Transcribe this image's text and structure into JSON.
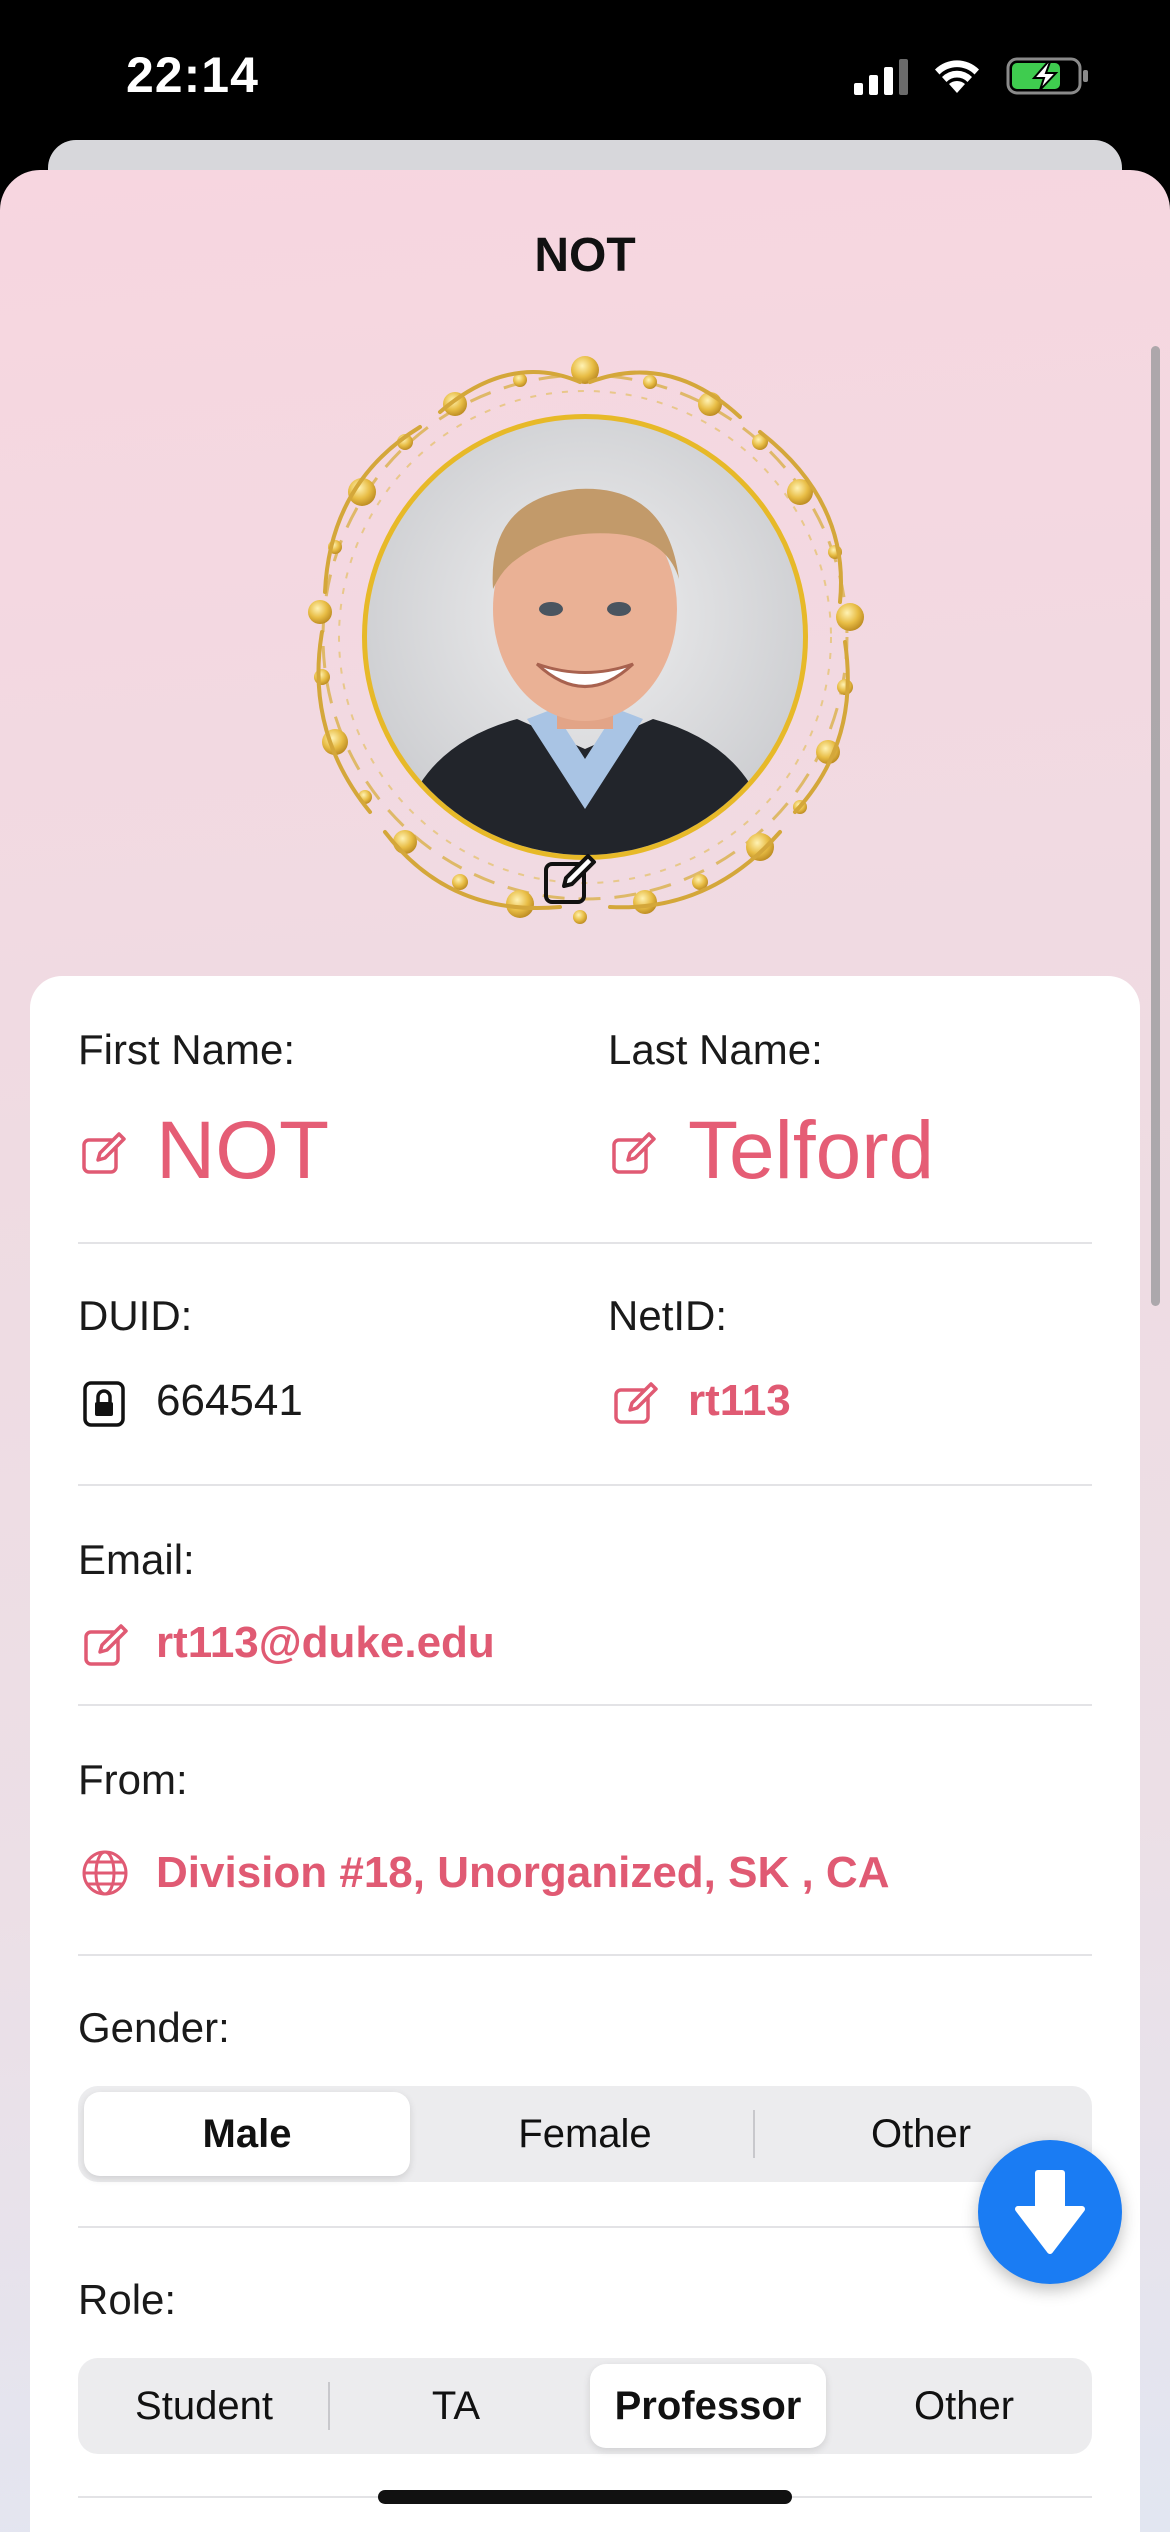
{
  "status_bar": {
    "time": "22:14"
  },
  "sheet": {
    "title": "NOT"
  },
  "profile": {
    "first_name_label": "First Name:",
    "first_name": "NOT",
    "last_name_label": "Last Name:",
    "last_name": "Telford",
    "duid_label": "DUID:",
    "duid": "664541",
    "netid_label": "NetID:",
    "netid": "rt113",
    "email_label": "Email:",
    "email": "rt113@duke.edu",
    "from_label": "From:",
    "from": "Division #18, Unorganized, SK , CA"
  },
  "gender": {
    "label": "Gender:",
    "options": [
      "Male",
      "Female",
      "Other"
    ],
    "selected": "Male"
  },
  "role": {
    "label": "Role:",
    "options": [
      "Student",
      "TA",
      "Professor",
      "Other"
    ],
    "selected": "Professor"
  },
  "colors": {
    "accent": "#e05a73",
    "fab": "#1a7cf3",
    "frame_gold": "#e7b928"
  },
  "icons": {
    "edit": "square-pencil-icon",
    "lock": "lock-icon",
    "globe": "globe-icon",
    "download": "arrow-down-icon"
  }
}
